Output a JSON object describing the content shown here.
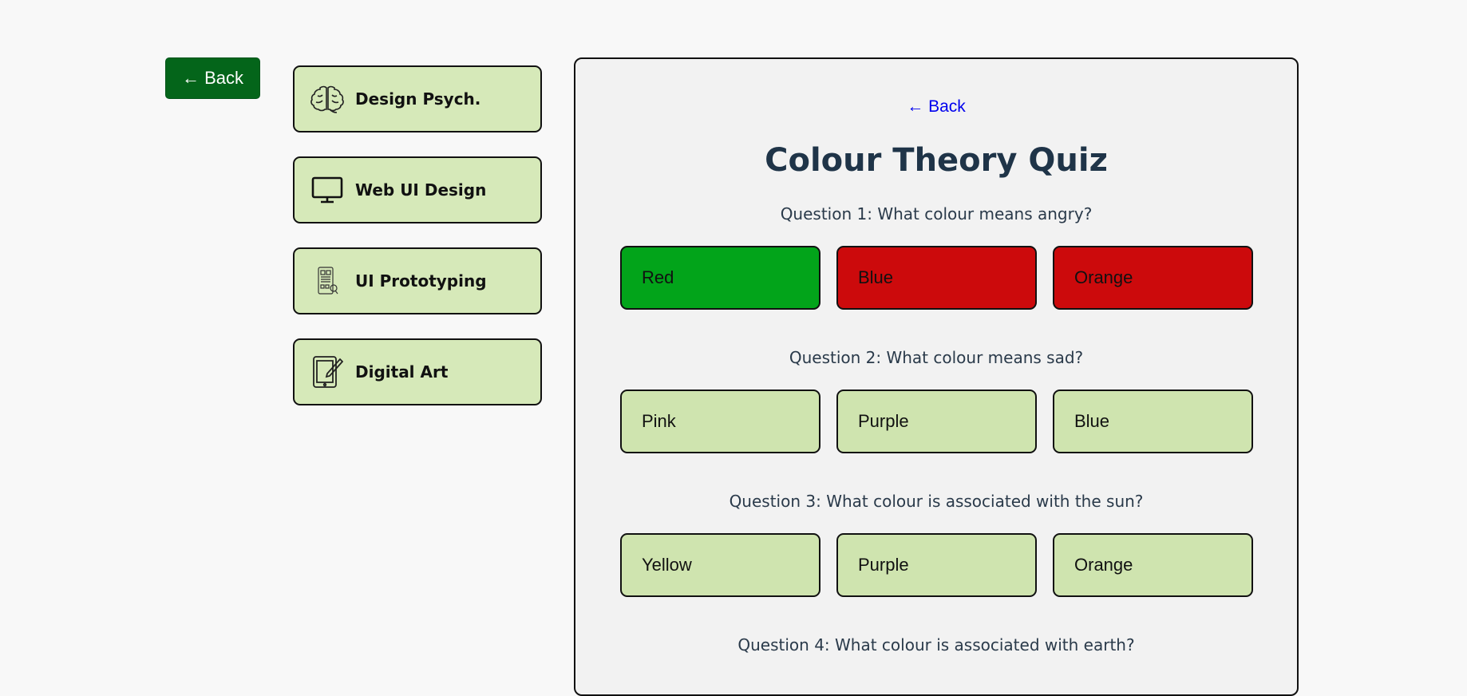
{
  "nav": {
    "back_label": "← Back"
  },
  "courses": [
    {
      "label": "Design Psych.",
      "icon": "brain-icon"
    },
    {
      "label": "Web UI Design",
      "icon": "monitor-icon"
    },
    {
      "label": "UI Prototyping",
      "icon": "prototype-icon"
    },
    {
      "label": "Digital Art",
      "icon": "tablet-pen-icon"
    }
  ],
  "quiz": {
    "back_label": "← Back",
    "title": "Colour Theory Quiz",
    "questions": [
      {
        "text": "Question 1: What colour means angry?",
        "options": [
          "Red",
          "Blue",
          "Orange"
        ],
        "states": [
          "correct",
          "wrong",
          "wrong"
        ]
      },
      {
        "text": "Question 2: What colour means sad?",
        "options": [
          "Pink",
          "Purple",
          "Blue"
        ],
        "states": [
          "none",
          "none",
          "none"
        ]
      },
      {
        "text": "Question 3: What colour is associated with the sun?",
        "options": [
          "Yellow",
          "Purple",
          "Orange"
        ],
        "states": [
          "none",
          "none",
          "none"
        ]
      },
      {
        "text": "Question 4: What colour is associated with earth?",
        "options": [],
        "states": []
      }
    ]
  },
  "colors": {
    "accent": "#04651a",
    "card": "#d6e9b9",
    "option": "#cfe4af",
    "correct": "#02a41a",
    "wrong": "#cc0a0c",
    "title": "#1f3448"
  }
}
